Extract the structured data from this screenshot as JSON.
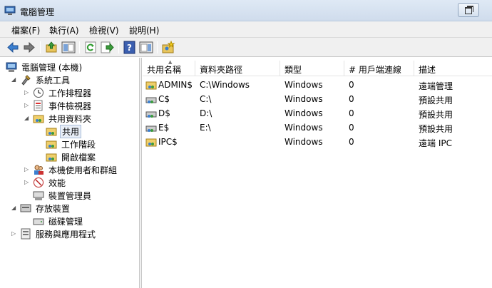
{
  "window": {
    "title": "電腦管理"
  },
  "menu": [
    "檔案(F)",
    "執行(A)",
    "檢視(V)",
    "說明(H)"
  ],
  "toolbar": {
    "buttons": [
      "back-icon",
      "forward-icon",
      "up-icon",
      "show-hide-tree-icon",
      "refresh-icon",
      "export-icon",
      "help-icon",
      "show-hide-action-icon",
      "new-share-icon"
    ]
  },
  "tree": [
    {
      "label": "電腦管理 (本機)",
      "icon": "computer-icon"
    },
    {
      "label": "系統工具",
      "icon": "tools-icon"
    },
    {
      "label": "工作排程器",
      "icon": "clock-icon"
    },
    {
      "label": "事件檢視器",
      "icon": "event-viewer-icon"
    },
    {
      "label": "共用資料夾",
      "icon": "shared-folder-icon"
    },
    {
      "label": "共用",
      "icon": "shared-folder-icon"
    },
    {
      "label": "工作階段",
      "icon": "shared-folder-icon"
    },
    {
      "label": "開啟檔案",
      "icon": "shared-folder-icon"
    },
    {
      "label": "本機使用者和群組",
      "icon": "users-icon"
    },
    {
      "label": "效能",
      "icon": "performance-icon"
    },
    {
      "label": "裝置管理員",
      "icon": "device-manager-icon"
    },
    {
      "label": "存放裝置",
      "icon": "storage-icon"
    },
    {
      "label": "磁碟管理",
      "icon": "disk-icon"
    },
    {
      "label": "服務與應用程式",
      "icon": "services-icon"
    }
  ],
  "list": {
    "columns": [
      "共用名稱",
      "資料夾路徑",
      "類型",
      "# 用戶端連線",
      "描述"
    ],
    "rows": [
      {
        "name": "ADMIN$",
        "path": "C:\\Windows",
        "type": "Windows",
        "clients": "0",
        "desc": "遠端管理",
        "icon": "share-folder-icon"
      },
      {
        "name": "C$",
        "path": "C:\\",
        "type": "Windows",
        "clients": "0",
        "desc": "預設共用",
        "icon": "share-drive-icon"
      },
      {
        "name": "D$",
        "path": "D:\\",
        "type": "Windows",
        "clients": "0",
        "desc": "預設共用",
        "icon": "share-drive-icon"
      },
      {
        "name": "E$",
        "path": "E:\\",
        "type": "Windows",
        "clients": "0",
        "desc": "預設共用",
        "icon": "share-drive-icon"
      },
      {
        "name": "IPC$",
        "path": "",
        "type": "Windows",
        "clients": "0",
        "desc": "遠端 IPC",
        "icon": "share-folder-icon"
      }
    ]
  }
}
